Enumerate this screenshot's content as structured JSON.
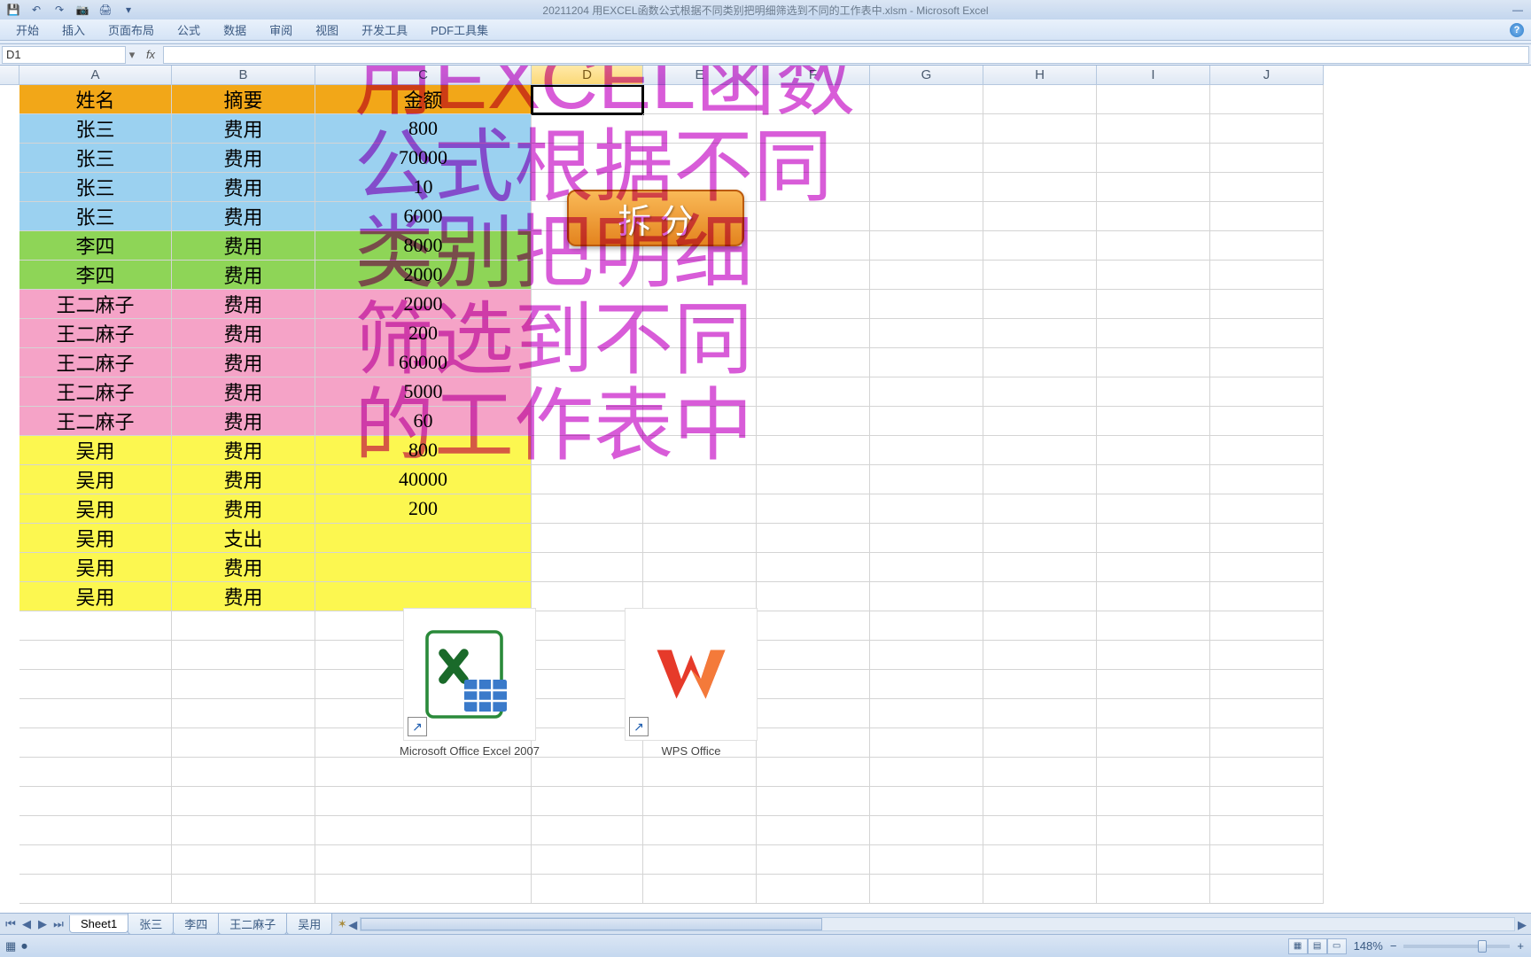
{
  "titlebar": {
    "title": "20211204 用EXCEL函数公式根据不同类别把明细筛选到不同的工作表中.xlsm - Microsoft Excel"
  },
  "ribbon": {
    "tabs": [
      "开始",
      "插入",
      "页面布局",
      "公式",
      "数据",
      "审阅",
      "视图",
      "开发工具",
      "PDF工具集"
    ]
  },
  "namebox": {
    "value": "D1"
  },
  "columns": [
    "A",
    "B",
    "C",
    "D",
    "E",
    "F",
    "G",
    "H",
    "I",
    "J"
  ],
  "selected_col": "D",
  "rows": [
    {
      "bg": "#f2a718",
      "cells": [
        "姓名",
        "摘要",
        "金额"
      ]
    },
    {
      "bg": "#9bd1f0",
      "cells": [
        "张三",
        "费用",
        "800"
      ]
    },
    {
      "bg": "#9bd1f0",
      "cells": [
        "张三",
        "费用",
        "70000"
      ]
    },
    {
      "bg": "#9bd1f0",
      "cells": [
        "张三",
        "费用",
        "10"
      ]
    },
    {
      "bg": "#9bd1f0",
      "cells": [
        "张三",
        "费用",
        "6000"
      ]
    },
    {
      "bg": "#8ed557",
      "cells": [
        "李四",
        "费用",
        "8000"
      ]
    },
    {
      "bg": "#8ed557",
      "cells": [
        "李四",
        "费用",
        "2000"
      ]
    },
    {
      "bg": "#f5a3c7",
      "cells": [
        "王二麻子",
        "费用",
        "2000"
      ]
    },
    {
      "bg": "#f5a3c7",
      "cells": [
        "王二麻子",
        "费用",
        "200"
      ]
    },
    {
      "bg": "#f5a3c7",
      "cells": [
        "王二麻子",
        "费用",
        "60000"
      ]
    },
    {
      "bg": "#f5a3c7",
      "cells": [
        "王二麻子",
        "费用",
        "5000"
      ]
    },
    {
      "bg": "#f5a3c7",
      "cells": [
        "王二麻子",
        "费用",
        "60"
      ]
    },
    {
      "bg": "#fcf750",
      "cells": [
        "吴用",
        "费用",
        "800"
      ]
    },
    {
      "bg": "#fcf750",
      "cells": [
        "吴用",
        "费用",
        "40000"
      ]
    },
    {
      "bg": "#fcf750",
      "cells": [
        "吴用",
        "费用",
        "200"
      ]
    },
    {
      "bg": "#fcf750",
      "cells": [
        "吴用",
        "支出",
        ""
      ]
    },
    {
      "bg": "#fcf750",
      "cells": [
        "吴用",
        "费用",
        ""
      ]
    },
    {
      "bg": "#fcf750",
      "cells": [
        "吴用",
        "费用",
        ""
      ]
    }
  ],
  "sheet_tabs": [
    "Sheet1",
    "张三",
    "李四",
    "王二麻子",
    "吴用"
  ],
  "active_tab": "Sheet1",
  "status": {
    "zoom": "148%",
    "minus": "−",
    "plus": "+"
  },
  "overlay_lines": [
    "用EXCEL函数",
    "公式根据不同",
    "类别把明细",
    "筛选到不同",
    "的工作表中"
  ],
  "split_btn": "拆 分",
  "icons": {
    "excel_label": "Microsoft Office Excel 2007",
    "wps_label": "WPS Office"
  }
}
